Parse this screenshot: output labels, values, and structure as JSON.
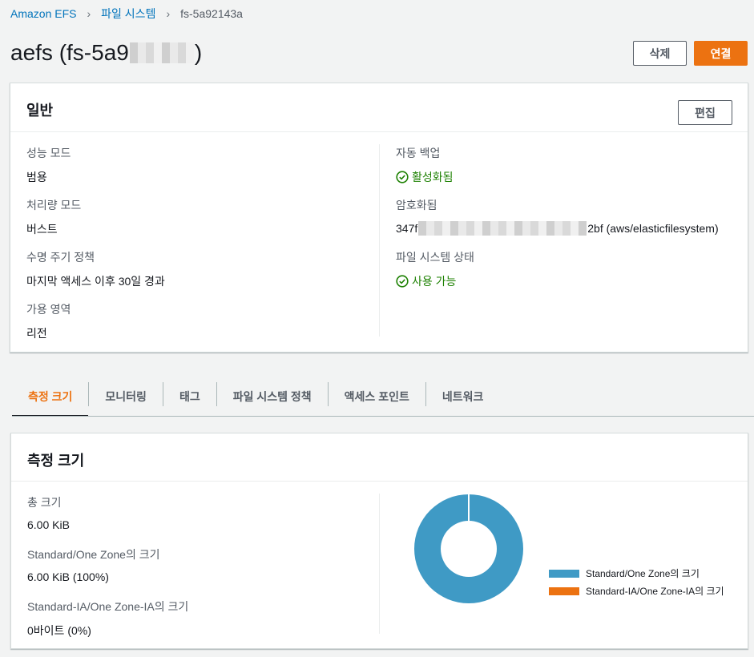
{
  "breadcrumb": {
    "root": "Amazon EFS",
    "section": "파일 시스템",
    "current": "fs-5a92143a"
  },
  "header": {
    "title_prefix": "aefs (fs-5a9",
    "title_suffix": ")",
    "delete_label": "삭제",
    "attach_label": "연결"
  },
  "general": {
    "title": "일반",
    "edit_label": "편집",
    "performance_mode": {
      "label": "성능 모드",
      "value": "범용"
    },
    "throughput_mode": {
      "label": "처리량 모드",
      "value": "버스트"
    },
    "lifecycle_policy": {
      "label": "수명 주기 정책",
      "value": "마지막 액세스 이후 30일 경과"
    },
    "availability_zone": {
      "label": "가용 영역",
      "value": "리전"
    },
    "auto_backup": {
      "label": "자동 백업",
      "value": "활성화됨"
    },
    "encryption": {
      "label": "암호화됨",
      "value_prefix": "347f",
      "value_suffix": "2bf (aws/elasticfilesystem)"
    },
    "fs_state": {
      "label": "파일 시스템 상태",
      "value": "사용 가능"
    }
  },
  "tabs": [
    "측정 크기",
    "모니터링",
    "태그",
    "파일 시스템 정책",
    "액세스 포인트",
    "네트워크"
  ],
  "metered_size": {
    "title": "측정 크기",
    "total": {
      "label": "총 크기",
      "value": "6.00 KiB"
    },
    "standard": {
      "label": "Standard/One Zone의 크기",
      "value": "6.00 KiB (100%)"
    },
    "ia": {
      "label": "Standard-IA/One Zone-IA의 크기",
      "value": "0바이트 (0%)"
    }
  },
  "chart_data": {
    "type": "pie",
    "categories": [
      "Standard/One Zone의 크기",
      "Standard-IA/One Zone-IA의 크기"
    ],
    "values": [
      100,
      0
    ],
    "colors": [
      "#3f9ac5",
      "#ec7211"
    ],
    "legend_position": "right"
  },
  "colors": {
    "accent": "#ec7211",
    "link": "#0073bb",
    "success": "#1d8102"
  }
}
